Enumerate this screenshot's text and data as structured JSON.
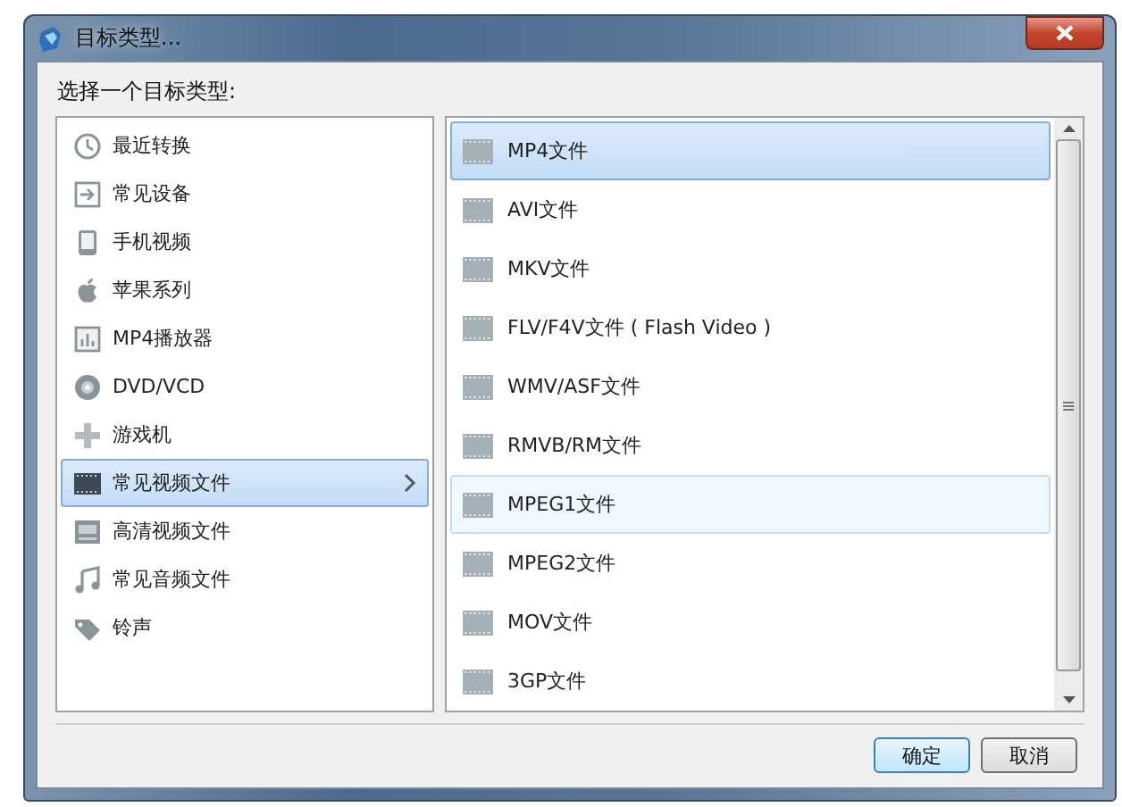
{
  "window": {
    "title": "目标类型..."
  },
  "prompt": "选择一个目标类型:",
  "categories": [
    {
      "label": "最近转换",
      "selected": false
    },
    {
      "label": "常见设备",
      "selected": false
    },
    {
      "label": "手机视频",
      "selected": false
    },
    {
      "label": "苹果系列",
      "selected": false
    },
    {
      "label": "MP4播放器",
      "selected": false
    },
    {
      "label": "DVD/VCD",
      "selected": false
    },
    {
      "label": "游戏机",
      "selected": false
    },
    {
      "label": "常见视频文件",
      "selected": true
    },
    {
      "label": "高清视频文件",
      "selected": false
    },
    {
      "label": "常见音频文件",
      "selected": false
    },
    {
      "label": "铃声",
      "selected": false
    }
  ],
  "formats": [
    {
      "label": "MP4文件",
      "selected": true,
      "hovered": false
    },
    {
      "label": "AVI文件",
      "selected": false,
      "hovered": false
    },
    {
      "label": "MKV文件",
      "selected": false,
      "hovered": false
    },
    {
      "label": "FLV/F4V文件 ( Flash Video )",
      "selected": false,
      "hovered": false
    },
    {
      "label": "WMV/ASF文件",
      "selected": false,
      "hovered": false
    },
    {
      "label": "RMVB/RM文件",
      "selected": false,
      "hovered": false
    },
    {
      "label": "MPEG1文件",
      "selected": false,
      "hovered": true
    },
    {
      "label": "MPEG2文件",
      "selected": false,
      "hovered": false
    },
    {
      "label": "MOV文件",
      "selected": false,
      "hovered": false
    },
    {
      "label": "3GP文件",
      "selected": false,
      "hovered": false
    }
  ],
  "buttons": [
    "确定",
    "取消"
  ]
}
